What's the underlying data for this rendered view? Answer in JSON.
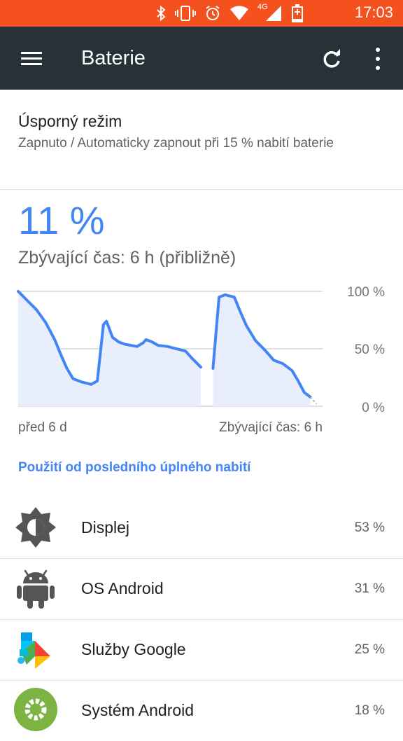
{
  "status_bar": {
    "time": "17:03",
    "network": "4G",
    "icons": [
      "bluetooth-icon",
      "vibrate-icon",
      "alarm-icon",
      "wifi-icon",
      "signal-icon",
      "battery-charging-icon"
    ]
  },
  "app_bar": {
    "title": "Baterie",
    "actions": [
      "menu-icon",
      "refresh-icon",
      "more-vert-icon"
    ]
  },
  "battery_saver": {
    "title": "Úsporný režim",
    "subtitle": "Zapnuto / Automaticky zapnout při 15 % nabití baterie"
  },
  "battery": {
    "percent": "11 %",
    "remaining": "Zbývající čas: 6 h (přibližně)"
  },
  "chart_data": {
    "type": "area",
    "y_labels": [
      "100 %",
      "50 %",
      "0 %"
    ],
    "x_labels": [
      "před 6 d",
      "Zbývající čas: 6 h"
    ],
    "ylim": [
      0,
      100
    ],
    "grid": true,
    "line_color": "#4285f4",
    "fill_color": "#e8eefc",
    "segments": [
      [
        [
          0,
          100
        ],
        [
          3,
          92
        ],
        [
          6,
          84
        ],
        [
          9,
          73
        ],
        [
          12,
          58
        ],
        [
          14,
          45
        ],
        [
          16,
          33
        ],
        [
          18,
          24
        ],
        [
          21,
          21
        ],
        [
          24,
          19
        ],
        [
          26,
          22
        ],
        [
          28,
          71
        ],
        [
          29,
          74
        ],
        [
          31,
          60
        ],
        [
          33,
          56
        ],
        [
          35,
          54
        ],
        [
          37,
          53
        ],
        [
          39,
          52
        ],
        [
          41,
          55
        ],
        [
          42,
          58
        ],
        [
          44,
          56
        ],
        [
          46,
          53
        ],
        [
          49,
          52
        ],
        [
          52,
          50
        ],
        [
          55,
          48
        ],
        [
          57,
          42
        ],
        [
          60,
          34
        ]
      ],
      [
        [
          64,
          33
        ],
        [
          66,
          95
        ],
        [
          68,
          97
        ],
        [
          71,
          95
        ],
        [
          73,
          82
        ],
        [
          75,
          70
        ],
        [
          78,
          57
        ],
        [
          81,
          49
        ],
        [
          84,
          40
        ],
        [
          87,
          37
        ],
        [
          90,
          31
        ],
        [
          92,
          22
        ],
        [
          94,
          12
        ],
        [
          96,
          8
        ]
      ]
    ],
    "projection": [
      [
        96,
        8
      ],
      [
        98,
        2
      ]
    ]
  },
  "usage_link": "Použití od posledního úplného nabití",
  "apps": [
    {
      "name": "Displej",
      "percent": "53 %",
      "icon": "brightness-icon"
    },
    {
      "name": "OS Android",
      "percent": "31 %",
      "icon": "android-icon"
    },
    {
      "name": "Služby Google",
      "percent": "25 %",
      "icon": "google-play-services-icon"
    },
    {
      "name": "Systém Android",
      "percent": "18 %",
      "icon": "android-settings-icon"
    }
  ],
  "colors": {
    "status_bar": "#f4511e",
    "app_bar": "#263238",
    "accent": "#4285f4"
  }
}
